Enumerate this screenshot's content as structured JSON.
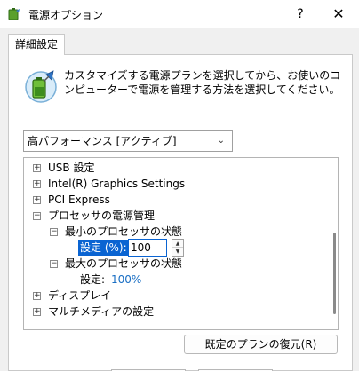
{
  "window": {
    "title": "電源オプション",
    "help_label": "?",
    "close_label": "✕"
  },
  "tab": {
    "label": "詳細設定"
  },
  "description": "カスタマイズする電源プランを選択してから、お使いのコンピューターで電源を管理する方法を選択してください。",
  "plan_select": {
    "value": "高パフォーマンス [アクティブ]"
  },
  "tree": {
    "usb": "USB 設定",
    "intel_graphics": "Intel(R) Graphics Settings",
    "pci_express": "PCI Express",
    "processor_power": "プロセッサの電源管理",
    "min_processor_state": "最小のプロセッサの状態",
    "min_setting_label": "設定 (%):",
    "min_setting_value": "100",
    "max_processor_state": "最大のプロセッサの状態",
    "max_setting_label": "設定:",
    "max_setting_value": "100%",
    "display": "ディスプレイ",
    "multimedia": "マルチメディアの設定"
  },
  "restore_button": {
    "label": "既定のプランの復元(R)"
  },
  "colors": {
    "accent": "#0a64d2",
    "link": "#1a6fc4"
  },
  "icons": {
    "app": "battery-icon",
    "plan": "battery-power-icon"
  }
}
